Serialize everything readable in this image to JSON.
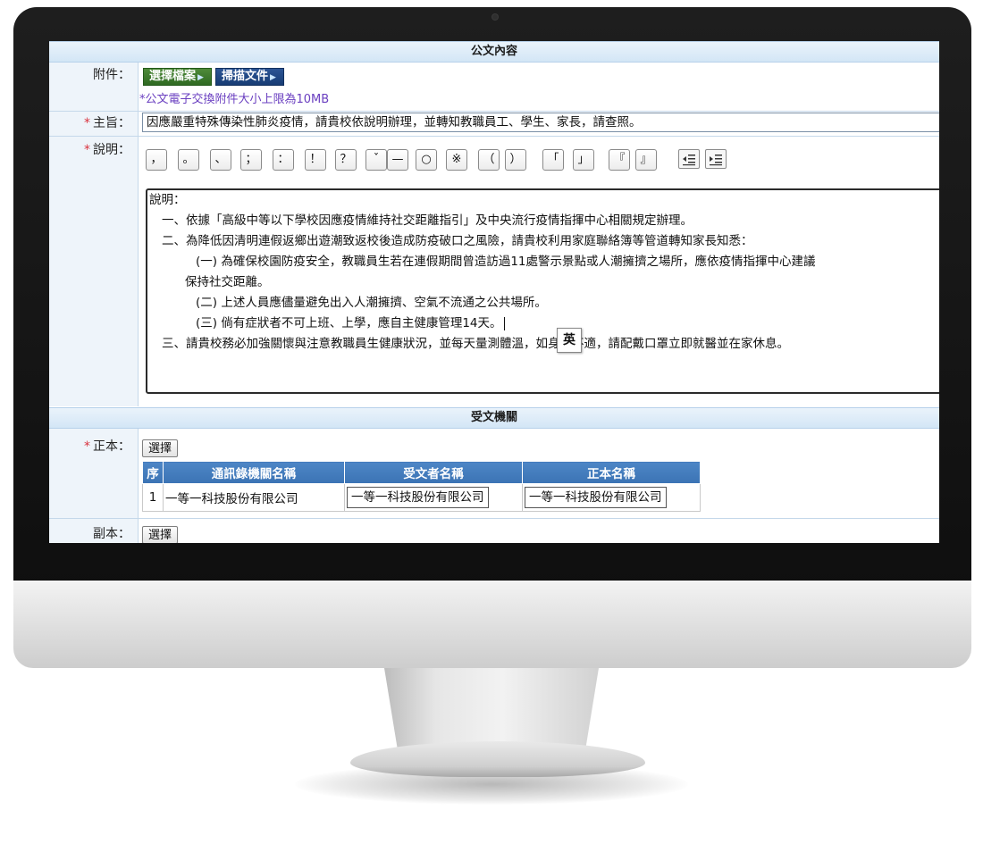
{
  "document_section": {
    "header": "公文內容",
    "attachment": {
      "label": "附件：",
      "choose_file_label": "選擇檔案",
      "scan_label": "掃描文件",
      "hint": "*公文電子交換附件大小上限為10MB"
    },
    "subject": {
      "required_mark": "*",
      "label": "主旨：",
      "value": "因應嚴重特殊傳染性肺炎疫情，請貴校依說明辦理，並轉知教職員工、學生、家長，請查照。"
    },
    "description": {
      "required_mark": "*",
      "label": "說明：",
      "punctuation_buttons": [
        "，",
        "。",
        "、",
        "；",
        "：",
        "！",
        "？",
        "ˇ",
        "—",
        "○",
        "※",
        "（",
        "）",
        "「",
        "」",
        "『",
        "』"
      ],
      "lines": [
        "說明：",
        "一、依據「高級中等以下學校因應疫情維持社交距離指引」及中央流行疫情指揮中心相關規定辦理。",
        "二、為降低因清明連假返鄉出遊潮致返校後造成防疫破口之風險，請貴校利用家庭聯絡簿等管道轉知家長知悉：",
        "(一) 為確保校園防疫安全，教職員生若在連假期間曾造訪過11處警示景點或人潮擁擠之場所，應依疫情指揮中心建議",
        "保持社交距離。",
        "(二) 上述人員應儘量避免出入人潮擁擠、空氣不流通之公共場所。",
        "(三) 倘有症狀者不可上班、上學，應自主健康管理14天。",
        "三、請貴校務必加強關懷與注意教職員生健康狀況，並每天量測體溫，如身體不適，請配戴口罩立即就醫並在家休息。"
      ],
      "ime_indicator": "英"
    }
  },
  "recipient_section": {
    "header": "受文機關",
    "main_recipient": {
      "required_mark": "*",
      "label": "正本：",
      "select_label": "選擇",
      "table": {
        "headers": [
          "序",
          "通訊錄機關名稱",
          "受文者名稱",
          "正本名稱"
        ],
        "rows": [
          [
            "1",
            "一等一科技股份有限公司",
            "一等一科技股份有限公司",
            "一等一科技股份有限公司"
          ]
        ]
      }
    },
    "copy_recipient": {
      "label": "副本：",
      "select_label": "選擇"
    }
  },
  "icons": [
    "indent-decrease-icon",
    "indent-increase-icon",
    "play-triangle-icon"
  ]
}
